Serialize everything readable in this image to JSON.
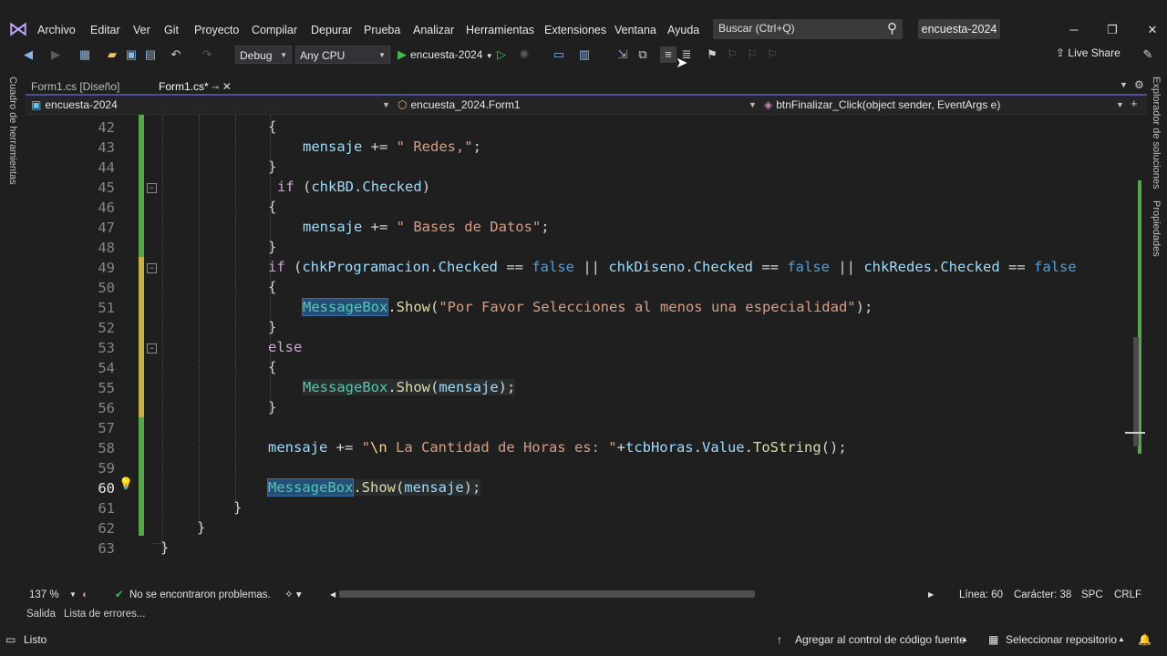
{
  "menu": {
    "items": [
      "Archivo",
      "Editar",
      "Ver",
      "Git",
      "Proyecto",
      "Compilar",
      "Depurar",
      "Prueba",
      "Analizar",
      "Herramientas",
      "Extensiones",
      "Ventana",
      "Ayuda"
    ],
    "search_placeholder": "Buscar (Ctrl+Q)",
    "solution_name": "encuesta-2024"
  },
  "toolbar": {
    "config": "Debug",
    "platform": "Any CPU",
    "run_target": "encuesta-2024",
    "live_share": "Live Share"
  },
  "left_rail": {
    "label": "Cuadro de herramientas"
  },
  "right_rail": {
    "solution_explorer": "Explorador de soluciones",
    "properties": "Propiedades"
  },
  "tabs": [
    {
      "label": "Form1.cs [Diseño]"
    },
    {
      "label": "Form1.cs*"
    }
  ],
  "navbar": {
    "project": "encuesta-2024",
    "class": "encuesta_2024.Form1",
    "member": "btnFinalizar_Click(object sender, EventArgs e)"
  },
  "editor": {
    "line_numbers": [
      "42",
      "43",
      "44",
      "45",
      "46",
      "47",
      "48",
      "49",
      "50",
      "51",
      "52",
      "53",
      "54",
      "55",
      "56",
      "57",
      "58",
      "59",
      "60",
      "61",
      "62",
      "63"
    ],
    "current_line": "60"
  },
  "editor_status": {
    "zoom": "137 %",
    "problems": "No se encontraron problemas.",
    "line": "Línea: 60",
    "char": "Carácter: 38",
    "spc": "SPC",
    "eol": "CRLF"
  },
  "panel_tabs": [
    "Salida",
    "Lista de errores..."
  ],
  "statusbar": {
    "ready": "Listo",
    "source_control": "Agregar al control de código fuente",
    "repo": "Seleccionar repositorio"
  },
  "colors": {
    "accent": "#8b7fff",
    "change_green": "#57a64a",
    "keyword": "#569cd6",
    "string": "#d69d85",
    "type": "#4ec9b0"
  }
}
